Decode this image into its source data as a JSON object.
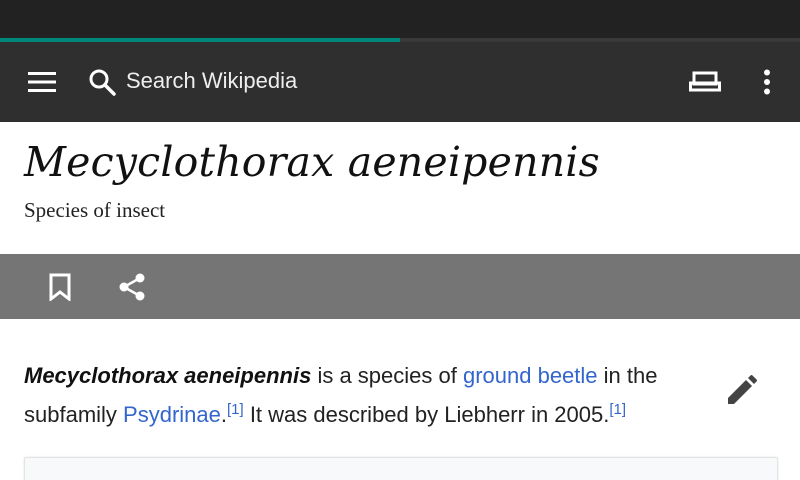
{
  "status_bar": {
    "color": "#222222"
  },
  "progress": {
    "fraction": 0.5,
    "color": "#00897b"
  },
  "toolbar": {
    "background": "#2f2f2f",
    "menu_icon": "hamburger-menu-icon",
    "search_icon": "magnifier-icon",
    "search_placeholder": "Search Wikipedia",
    "reading_icon": "reading-lists-icon",
    "overflow_icon": "vertical-ellipsis-icon"
  },
  "article": {
    "title": "Mecyclothorax aeneipennis",
    "description": "Species of insect"
  },
  "actions": {
    "bookmark_icon": "bookmark-outline-icon",
    "share_icon": "share-icon"
  },
  "body": {
    "bold_name": "Mecyclothorax aeneipennis",
    "text_1": " is a species of ",
    "link_1": "ground beetle",
    "text_2": " in the subfamily ",
    "link_2": "Psydrinae",
    "text_3": ".",
    "ref_1": "[1]",
    "text_4": " It was described by Liebherr in 2005.",
    "ref_2": "[1]",
    "edit_icon": "pencil-edit-icon",
    "link_color": "#3366cc"
  }
}
